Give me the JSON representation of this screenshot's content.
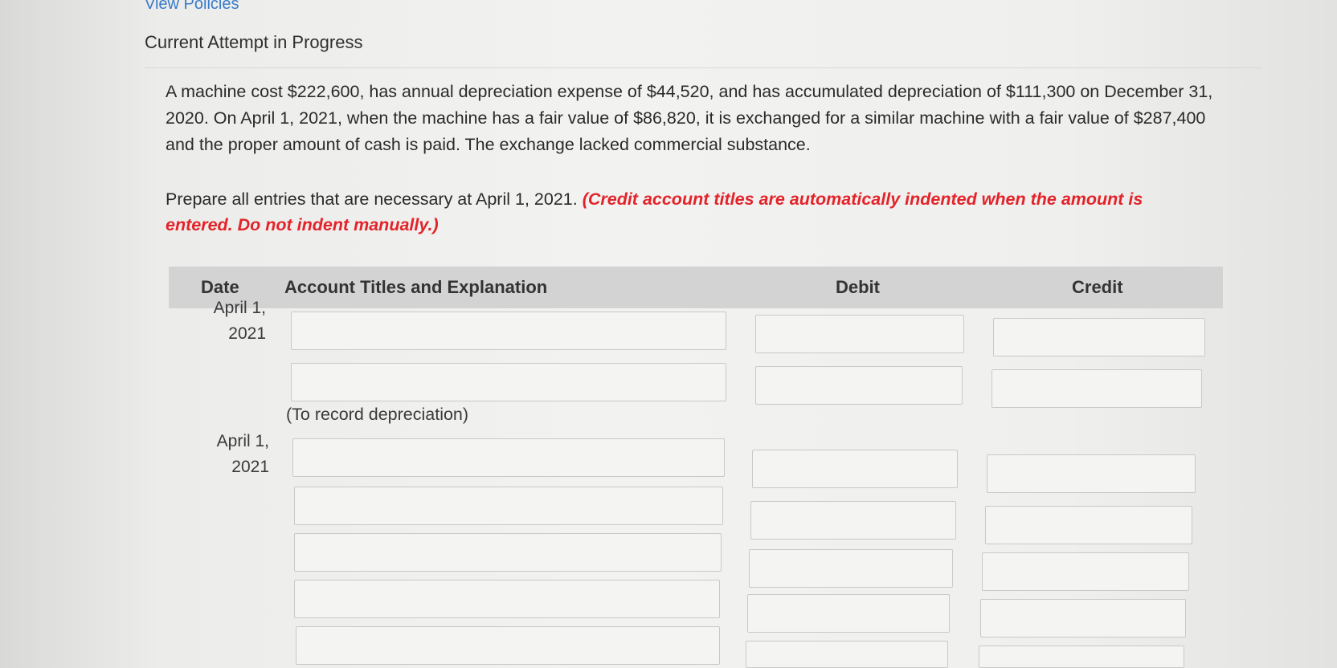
{
  "header": {
    "view_policies_link": "View Policies",
    "attempt_title": "Current Attempt in Progress"
  },
  "problem": {
    "text": "A machine cost $222,600, has annual depreciation expense of $44,520, and has accumulated depreciation of $111,300 on December 31, 2020. On April 1, 2021, when the machine has a fair value of $86,820, it is exchanged for a similar machine with a fair value of $287,400 and the proper amount of cash is paid. The exchange lacked commercial substance."
  },
  "instruction": {
    "main": "Prepare all entries that are necessary at April 1, 2021. ",
    "note": "(Credit account titles are automatically indented when the amount is entered. Do not indent manually.)"
  },
  "table": {
    "headers": {
      "date": "Date",
      "account": "Account Titles and Explanation",
      "debit": "Debit",
      "credit": "Credit"
    },
    "entries": [
      {
        "date_line1": "April 1,",
        "date_line2": "2021",
        "explanation": "(To record depreciation)"
      },
      {
        "date_line1": "April 1,",
        "date_line2": "2021"
      }
    ]
  }
}
